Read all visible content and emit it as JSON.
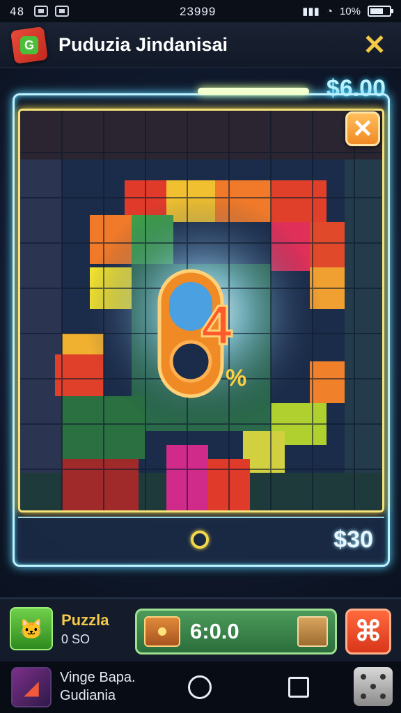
{
  "status_bar": {
    "time": "48",
    "clock": "23999",
    "battery": "10%"
  },
  "header": {
    "title": "Puduzia Jindanisai"
  },
  "game": {
    "price_top": "$6.00",
    "price_bottom": "$30",
    "center_glyph": "4",
    "center_sub": "%"
  },
  "player": {
    "name": "Puzzla",
    "sub": "0 SO"
  },
  "coin_bar": {
    "value": "6:0.0"
  },
  "navbar": {
    "app_line1": "Vinge Bapa.",
    "app_line2": "Gudiania"
  },
  "colors": {
    "neon": "#bff1ff",
    "board_border": "#f5e27a",
    "accent_orange": "#f08a25",
    "coin_green": "#4c9a5a"
  }
}
